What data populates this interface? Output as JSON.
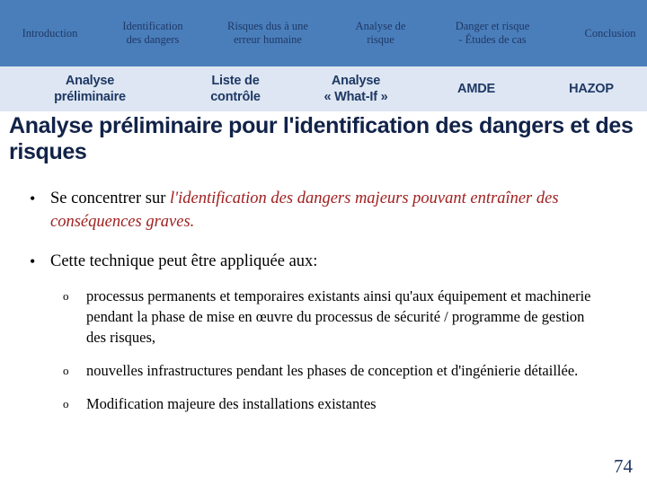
{
  "nav_primary": {
    "items": [
      {
        "label": "Introduction",
        "tone": "black",
        "width_class": "w0"
      },
      {
        "label": "Identification\ndes dangers",
        "tone": "white",
        "width_class": "w1"
      },
      {
        "label": "Risques dus à une\nerreur humaine",
        "tone": "navy",
        "width_class": "w2"
      },
      {
        "label": "Analyse de\nrisque",
        "tone": "navy",
        "width_class": "w3"
      },
      {
        "label": "Danger et risque\n- Études de cas",
        "tone": "navy",
        "width_class": "w4"
      },
      {
        "label": "Conclusion",
        "tone": "navy",
        "width_class": "w5"
      }
    ],
    "background_color": "#4a7ebb",
    "active_label": "Identification des dangers"
  },
  "nav_secondary": {
    "items": [
      {
        "label": "Analyse\npréliminaire",
        "tone": "red",
        "width_class": "s0"
      },
      {
        "label": "Liste de\ncontrôle",
        "tone": "navy",
        "width_class": "s1"
      },
      {
        "label": "Analyse\n« What-If »",
        "tone": "navy",
        "width_class": "s2"
      },
      {
        "label": "AMDE",
        "tone": "navy",
        "width_class": "s3"
      },
      {
        "label": "HAZOP",
        "tone": "navy",
        "width_class": "s4"
      }
    ],
    "background_color": "#dde6f2",
    "active_label": "Analyse préliminaire",
    "active_color": "#a81a18"
  },
  "slide": {
    "title": "Analyse préliminaire pour l'identification des dangers et des risques",
    "title_color": "#122349",
    "bullet_marker": "•",
    "subbullet_marker": "o",
    "bullets": [
      {
        "marker": "•",
        "lead_text": "Se concentrer sur ",
        "emphasis_text": "l'identification des dangers majeurs pouvant entraîner des conséquences graves.",
        "emphasis_color": "#a02020"
      },
      {
        "marker": "•",
        "lead_text": "Cette technique peut être appliquée  aux:",
        "emphasis_text": "",
        "emphasis_color": "#a02020"
      }
    ],
    "subbullets": [
      {
        "marker": "o",
        "text": "processus permanents et temporaires existants ainsi qu'aux équipement et machinerie pendant la phase de mise en œuvre du processus de sécurité / programme de gestion des risques,"
      },
      {
        "marker": "o",
        "text": "nouvelles infrastructures pendant les phases de conception et d'ingénierie détaillée."
      },
      {
        "marker": "o",
        "text": "Modification majeure des installations existantes"
      }
    ],
    "page_number": "74"
  }
}
